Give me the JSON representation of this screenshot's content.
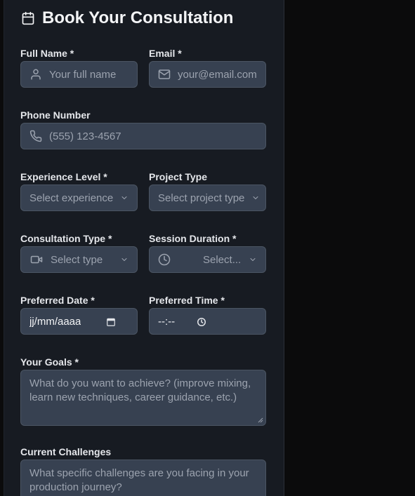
{
  "form": {
    "title": "Book Your Consultation",
    "full_name": {
      "label": "Full Name *",
      "placeholder": "Your full name"
    },
    "email": {
      "label": "Email *",
      "placeholder": "your@email.com"
    },
    "phone": {
      "label": "Phone Number",
      "placeholder": "(555) 123-4567"
    },
    "experience": {
      "label": "Experience Level *",
      "placeholder": "Select experience"
    },
    "project_type": {
      "label": "Project Type",
      "placeholder": "Select project type"
    },
    "consultation_type": {
      "label": "Consultation Type *",
      "placeholder": "Select type"
    },
    "session_duration": {
      "label": "Session Duration *",
      "placeholder": "Select..."
    },
    "preferred_date": {
      "label": "Preferred Date *",
      "value": "jj/mm/aaaa"
    },
    "preferred_time": {
      "label": "Preferred Time *",
      "value": "--:--"
    },
    "goals": {
      "label": "Your Goals *",
      "placeholder": "What do you want to achieve? (improve mixing, learn new techniques, career guidance, etc.)"
    },
    "challenges": {
      "label": "Current Challenges",
      "placeholder": "What specific challenges are you facing in your production journey?"
    }
  },
  "icons": [
    "calendar-icon",
    "user-icon",
    "mail-icon",
    "phone-icon",
    "video-icon",
    "clock-icon",
    "chevron-down-icon"
  ],
  "colors": {
    "panel_bg": "#171b22",
    "page_bg": "#0b0b0c",
    "field_bg": "#374151",
    "field_border": "#4b5563"
  }
}
